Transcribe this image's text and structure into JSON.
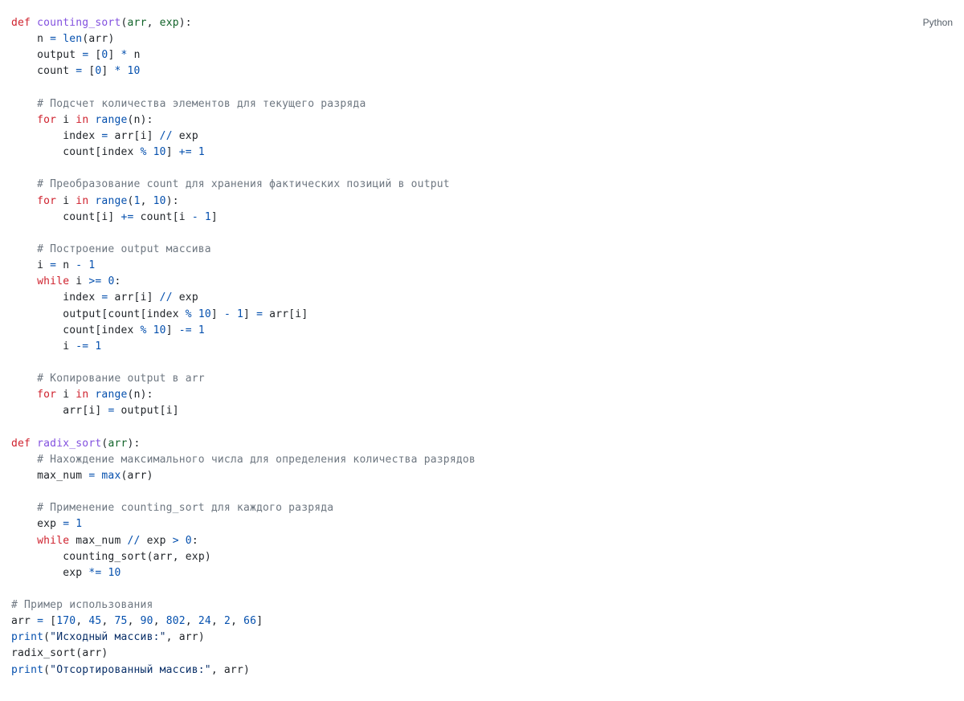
{
  "language_label": "Python",
  "code": {
    "lines": [
      [
        [
          "kw",
          "def"
        ],
        [
          "",
          null,
          " "
        ],
        [
          "fn",
          "counting_sort"
        ],
        [
          "punct",
          "("
        ],
        [
          "param",
          "arr"
        ],
        [
          "punct",
          ", "
        ],
        [
          "param",
          "exp"
        ],
        [
          "punct",
          "):"
        ]
      ],
      [
        [
          "",
          null,
          "    "
        ],
        [
          "var",
          "n"
        ],
        [
          "",
          null,
          " "
        ],
        [
          "op",
          "="
        ],
        [
          "",
          null,
          " "
        ],
        [
          "builtin",
          "len"
        ],
        [
          "punct",
          "("
        ],
        [
          "var",
          "arr"
        ],
        [
          "punct",
          ")"
        ]
      ],
      [
        [
          "",
          null,
          "    "
        ],
        [
          "var",
          "output"
        ],
        [
          "",
          null,
          " "
        ],
        [
          "op",
          "="
        ],
        [
          "",
          null,
          " "
        ],
        [
          "punct",
          "["
        ],
        [
          "num",
          "0"
        ],
        [
          "punct",
          "]"
        ],
        [
          "",
          null,
          " "
        ],
        [
          "op",
          "*"
        ],
        [
          "",
          null,
          " "
        ],
        [
          "var",
          "n"
        ]
      ],
      [
        [
          "",
          null,
          "    "
        ],
        [
          "var",
          "count"
        ],
        [
          "",
          null,
          " "
        ],
        [
          "op",
          "="
        ],
        [
          "",
          null,
          " "
        ],
        [
          "punct",
          "["
        ],
        [
          "num",
          "0"
        ],
        [
          "punct",
          "]"
        ],
        [
          "",
          null,
          " "
        ],
        [
          "op",
          "*"
        ],
        [
          "",
          null,
          " "
        ],
        [
          "num",
          "10"
        ]
      ],
      [
        [
          "",
          null,
          ""
        ]
      ],
      [
        [
          "",
          null,
          "    "
        ],
        [
          "cmt",
          "# Подсчет количества элементов для текущего разряда"
        ]
      ],
      [
        [
          "",
          null,
          "    "
        ],
        [
          "kw",
          "for"
        ],
        [
          "",
          null,
          " "
        ],
        [
          "var",
          "i"
        ],
        [
          "",
          null,
          " "
        ],
        [
          "kw",
          "in"
        ],
        [
          "",
          null,
          " "
        ],
        [
          "builtin",
          "range"
        ],
        [
          "punct",
          "("
        ],
        [
          "var",
          "n"
        ],
        [
          "punct",
          "):"
        ]
      ],
      [
        [
          "",
          null,
          "        "
        ],
        [
          "var",
          "index"
        ],
        [
          "",
          null,
          " "
        ],
        [
          "op",
          "="
        ],
        [
          "",
          null,
          " "
        ],
        [
          "var",
          "arr"
        ],
        [
          "punct",
          "["
        ],
        [
          "var",
          "i"
        ],
        [
          "punct",
          "]"
        ],
        [
          "",
          null,
          " "
        ],
        [
          "op",
          "//"
        ],
        [
          "",
          null,
          " "
        ],
        [
          "var",
          "exp"
        ]
      ],
      [
        [
          "",
          null,
          "        "
        ],
        [
          "var",
          "count"
        ],
        [
          "punct",
          "["
        ],
        [
          "var",
          "index"
        ],
        [
          "",
          null,
          " "
        ],
        [
          "op",
          "%"
        ],
        [
          "",
          null,
          " "
        ],
        [
          "num",
          "10"
        ],
        [
          "punct",
          "]"
        ],
        [
          "",
          null,
          " "
        ],
        [
          "op",
          "+="
        ],
        [
          "",
          null,
          " "
        ],
        [
          "num",
          "1"
        ]
      ],
      [
        [
          "",
          null,
          ""
        ]
      ],
      [
        [
          "",
          null,
          "    "
        ],
        [
          "cmt",
          "# Преобразование count для хранения фактических позиций в output"
        ]
      ],
      [
        [
          "",
          null,
          "    "
        ],
        [
          "kw",
          "for"
        ],
        [
          "",
          null,
          " "
        ],
        [
          "var",
          "i"
        ],
        [
          "",
          null,
          " "
        ],
        [
          "kw",
          "in"
        ],
        [
          "",
          null,
          " "
        ],
        [
          "builtin",
          "range"
        ],
        [
          "punct",
          "("
        ],
        [
          "num",
          "1"
        ],
        [
          "punct",
          ", "
        ],
        [
          "num",
          "10"
        ],
        [
          "punct",
          "):"
        ]
      ],
      [
        [
          "",
          null,
          "        "
        ],
        [
          "var",
          "count"
        ],
        [
          "punct",
          "["
        ],
        [
          "var",
          "i"
        ],
        [
          "punct",
          "]"
        ],
        [
          "",
          null,
          " "
        ],
        [
          "op",
          "+="
        ],
        [
          "",
          null,
          " "
        ],
        [
          "var",
          "count"
        ],
        [
          "punct",
          "["
        ],
        [
          "var",
          "i"
        ],
        [
          "",
          null,
          " "
        ],
        [
          "op",
          "-"
        ],
        [
          "",
          null,
          " "
        ],
        [
          "num",
          "1"
        ],
        [
          "punct",
          "]"
        ]
      ],
      [
        [
          "",
          null,
          ""
        ]
      ],
      [
        [
          "",
          null,
          "    "
        ],
        [
          "cmt",
          "# Построение output массива"
        ]
      ],
      [
        [
          "",
          null,
          "    "
        ],
        [
          "var",
          "i"
        ],
        [
          "",
          null,
          " "
        ],
        [
          "op",
          "="
        ],
        [
          "",
          null,
          " "
        ],
        [
          "var",
          "n"
        ],
        [
          "",
          null,
          " "
        ],
        [
          "op",
          "-"
        ],
        [
          "",
          null,
          " "
        ],
        [
          "num",
          "1"
        ]
      ],
      [
        [
          "",
          null,
          "    "
        ],
        [
          "kw",
          "while"
        ],
        [
          "",
          null,
          " "
        ],
        [
          "var",
          "i"
        ],
        [
          "",
          null,
          " "
        ],
        [
          "op",
          ">="
        ],
        [
          "",
          null,
          " "
        ],
        [
          "num",
          "0"
        ],
        [
          "punct",
          ":"
        ]
      ],
      [
        [
          "",
          null,
          "        "
        ],
        [
          "var",
          "index"
        ],
        [
          "",
          null,
          " "
        ],
        [
          "op",
          "="
        ],
        [
          "",
          null,
          " "
        ],
        [
          "var",
          "arr"
        ],
        [
          "punct",
          "["
        ],
        [
          "var",
          "i"
        ],
        [
          "punct",
          "]"
        ],
        [
          "",
          null,
          " "
        ],
        [
          "op",
          "//"
        ],
        [
          "",
          null,
          " "
        ],
        [
          "var",
          "exp"
        ]
      ],
      [
        [
          "",
          null,
          "        "
        ],
        [
          "var",
          "output"
        ],
        [
          "punct",
          "["
        ],
        [
          "var",
          "count"
        ],
        [
          "punct",
          "["
        ],
        [
          "var",
          "index"
        ],
        [
          "",
          null,
          " "
        ],
        [
          "op",
          "%"
        ],
        [
          "",
          null,
          " "
        ],
        [
          "num",
          "10"
        ],
        [
          "punct",
          "]"
        ],
        [
          "",
          null,
          " "
        ],
        [
          "op",
          "-"
        ],
        [
          "",
          null,
          " "
        ],
        [
          "num",
          "1"
        ],
        [
          "punct",
          "]"
        ],
        [
          "",
          null,
          " "
        ],
        [
          "op",
          "="
        ],
        [
          "",
          null,
          " "
        ],
        [
          "var",
          "arr"
        ],
        [
          "punct",
          "["
        ],
        [
          "var",
          "i"
        ],
        [
          "punct",
          "]"
        ]
      ],
      [
        [
          "",
          null,
          "        "
        ],
        [
          "var",
          "count"
        ],
        [
          "punct",
          "["
        ],
        [
          "var",
          "index"
        ],
        [
          "",
          null,
          " "
        ],
        [
          "op",
          "%"
        ],
        [
          "",
          null,
          " "
        ],
        [
          "num",
          "10"
        ],
        [
          "punct",
          "]"
        ],
        [
          "",
          null,
          " "
        ],
        [
          "op",
          "-="
        ],
        [
          "",
          null,
          " "
        ],
        [
          "num",
          "1"
        ]
      ],
      [
        [
          "",
          null,
          "        "
        ],
        [
          "var",
          "i"
        ],
        [
          "",
          null,
          " "
        ],
        [
          "op",
          "-="
        ],
        [
          "",
          null,
          " "
        ],
        [
          "num",
          "1"
        ]
      ],
      [
        [
          "",
          null,
          ""
        ]
      ],
      [
        [
          "",
          null,
          "    "
        ],
        [
          "cmt",
          "# Копирование output в arr"
        ]
      ],
      [
        [
          "",
          null,
          "    "
        ],
        [
          "kw",
          "for"
        ],
        [
          "",
          null,
          " "
        ],
        [
          "var",
          "i"
        ],
        [
          "",
          null,
          " "
        ],
        [
          "kw",
          "in"
        ],
        [
          "",
          null,
          " "
        ],
        [
          "builtin",
          "range"
        ],
        [
          "punct",
          "("
        ],
        [
          "var",
          "n"
        ],
        [
          "punct",
          "):"
        ]
      ],
      [
        [
          "",
          null,
          "        "
        ],
        [
          "var",
          "arr"
        ],
        [
          "punct",
          "["
        ],
        [
          "var",
          "i"
        ],
        [
          "punct",
          "]"
        ],
        [
          "",
          null,
          " "
        ],
        [
          "op",
          "="
        ],
        [
          "",
          null,
          " "
        ],
        [
          "var",
          "output"
        ],
        [
          "punct",
          "["
        ],
        [
          "var",
          "i"
        ],
        [
          "punct",
          "]"
        ]
      ],
      [
        [
          "",
          null,
          ""
        ]
      ],
      [
        [
          "kw",
          "def"
        ],
        [
          "",
          null,
          " "
        ],
        [
          "fn",
          "radix_sort"
        ],
        [
          "punct",
          "("
        ],
        [
          "param",
          "arr"
        ],
        [
          "punct",
          "):"
        ]
      ],
      [
        [
          "",
          null,
          "    "
        ],
        [
          "cmt",
          "# Нахождение максимального числа для определения количества разрядов"
        ]
      ],
      [
        [
          "",
          null,
          "    "
        ],
        [
          "var",
          "max_num"
        ],
        [
          "",
          null,
          " "
        ],
        [
          "op",
          "="
        ],
        [
          "",
          null,
          " "
        ],
        [
          "builtin",
          "max"
        ],
        [
          "punct",
          "("
        ],
        [
          "var",
          "arr"
        ],
        [
          "punct",
          ")"
        ]
      ],
      [
        [
          "",
          null,
          ""
        ]
      ],
      [
        [
          "",
          null,
          "    "
        ],
        [
          "cmt",
          "# Применение counting_sort для каждого разряда"
        ]
      ],
      [
        [
          "",
          null,
          "    "
        ],
        [
          "var",
          "exp"
        ],
        [
          "",
          null,
          " "
        ],
        [
          "op",
          "="
        ],
        [
          "",
          null,
          " "
        ],
        [
          "num",
          "1"
        ]
      ],
      [
        [
          "",
          null,
          "    "
        ],
        [
          "kw",
          "while"
        ],
        [
          "",
          null,
          " "
        ],
        [
          "var",
          "max_num"
        ],
        [
          "",
          null,
          " "
        ],
        [
          "op",
          "//"
        ],
        [
          "",
          null,
          " "
        ],
        [
          "var",
          "exp"
        ],
        [
          "",
          null,
          " "
        ],
        [
          "op",
          ">"
        ],
        [
          "",
          null,
          " "
        ],
        [
          "num",
          "0"
        ],
        [
          "punct",
          ":"
        ]
      ],
      [
        [
          "",
          null,
          "        "
        ],
        [
          "var",
          "counting_sort"
        ],
        [
          "punct",
          "("
        ],
        [
          "var",
          "arr"
        ],
        [
          "punct",
          ", "
        ],
        [
          "var",
          "exp"
        ],
        [
          "punct",
          ")"
        ]
      ],
      [
        [
          "",
          null,
          "        "
        ],
        [
          "var",
          "exp"
        ],
        [
          "",
          null,
          " "
        ],
        [
          "op",
          "*="
        ],
        [
          "",
          null,
          " "
        ],
        [
          "num",
          "10"
        ]
      ],
      [
        [
          "",
          null,
          ""
        ]
      ],
      [
        [
          "cmt",
          "# Пример использования"
        ]
      ],
      [
        [
          "var",
          "arr"
        ],
        [
          "",
          null,
          " "
        ],
        [
          "op",
          "="
        ],
        [
          "",
          null,
          " "
        ],
        [
          "punct",
          "["
        ],
        [
          "num",
          "170"
        ],
        [
          "punct",
          ", "
        ],
        [
          "num",
          "45"
        ],
        [
          "punct",
          ", "
        ],
        [
          "num",
          "75"
        ],
        [
          "punct",
          ", "
        ],
        [
          "num",
          "90"
        ],
        [
          "punct",
          ", "
        ],
        [
          "num",
          "802"
        ],
        [
          "punct",
          ", "
        ],
        [
          "num",
          "24"
        ],
        [
          "punct",
          ", "
        ],
        [
          "num",
          "2"
        ],
        [
          "punct",
          ", "
        ],
        [
          "num",
          "66"
        ],
        [
          "punct",
          "]"
        ]
      ],
      [
        [
          "builtin",
          "print"
        ],
        [
          "punct",
          "("
        ],
        [
          "str",
          "\"Исходный массив:\""
        ],
        [
          "punct",
          ", "
        ],
        [
          "var",
          "arr"
        ],
        [
          "punct",
          ")"
        ]
      ],
      [
        [
          "var",
          "radix_sort"
        ],
        [
          "punct",
          "("
        ],
        [
          "var",
          "arr"
        ],
        [
          "punct",
          ")"
        ]
      ],
      [
        [
          "builtin",
          "print"
        ],
        [
          "punct",
          "("
        ],
        [
          "str",
          "\"Отсортированный массив:\""
        ],
        [
          "punct",
          ", "
        ],
        [
          "var",
          "arr"
        ],
        [
          "punct",
          ")"
        ]
      ]
    ]
  }
}
